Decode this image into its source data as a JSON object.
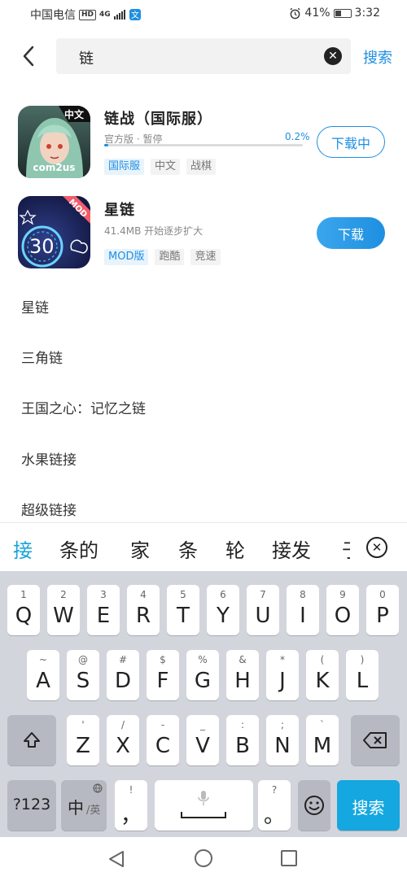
{
  "status": {
    "carrier": "中国电信",
    "hd": "HD",
    "network": "4G",
    "battery": "41%",
    "battery_level": 0.41,
    "time": "3:32"
  },
  "search": {
    "query": "链",
    "button_label": "搜索"
  },
  "apps": [
    {
      "title": "链战（国际服）",
      "status": "官方版 · 暂停",
      "progress_label": "0.2%",
      "progress": 0.002,
      "tags": [
        "国际服",
        "中文",
        "战棋"
      ],
      "button": "下载中",
      "icon_badge": "中文",
      "icon_brand": "com2us"
    },
    {
      "title": "星链",
      "status": "41.4MB  开始逐步扩大",
      "tags": [
        "MOD版",
        "跑酷",
        "竞速"
      ],
      "button": "下载",
      "icon_badge": "MOD",
      "icon_number": "30"
    }
  ],
  "suggestions": [
    "星链",
    "三角链",
    "王国之心：记忆之链",
    "水果链接",
    "超级链接"
  ],
  "candidates": [
    "接",
    "条的",
    "家",
    "条",
    "轮",
    "接发",
    "于"
  ],
  "keyboard": {
    "row1": [
      {
        "hint": "1",
        "key": "Q"
      },
      {
        "hint": "2",
        "key": "W"
      },
      {
        "hint": "3",
        "key": "E"
      },
      {
        "hint": "4",
        "key": "R"
      },
      {
        "hint": "5",
        "key": "T"
      },
      {
        "hint": "6",
        "key": "Y"
      },
      {
        "hint": "7",
        "key": "U"
      },
      {
        "hint": "8",
        "key": "I"
      },
      {
        "hint": "9",
        "key": "O"
      },
      {
        "hint": "0",
        "key": "P"
      }
    ],
    "row2": [
      {
        "hint": "~",
        "key": "A"
      },
      {
        "hint": "@",
        "key": "S"
      },
      {
        "hint": "#",
        "key": "D"
      },
      {
        "hint": "$",
        "key": "F"
      },
      {
        "hint": "%",
        "key": "G"
      },
      {
        "hint": "&",
        "key": "H"
      },
      {
        "hint": "*",
        "key": "J"
      },
      {
        "hint": "(",
        "key": "K"
      },
      {
        "hint": ")",
        "key": "L"
      }
    ],
    "row3": [
      {
        "hint": "'",
        "key": "Z"
      },
      {
        "hint": "/",
        "key": "X"
      },
      {
        "hint": "-",
        "key": "C"
      },
      {
        "hint": "_",
        "key": "V"
      },
      {
        "hint": ":",
        "key": "B"
      },
      {
        "hint": ";",
        "key": "N"
      },
      {
        "hint": "`",
        "key": "M"
      }
    ],
    "sym_label": "?123",
    "lang_label": "中",
    "lang_alt": "/英",
    "comma_hint": "!",
    "comma_key": "，",
    "period_hint": "?",
    "period_key": "。",
    "enter_label": "搜索"
  }
}
